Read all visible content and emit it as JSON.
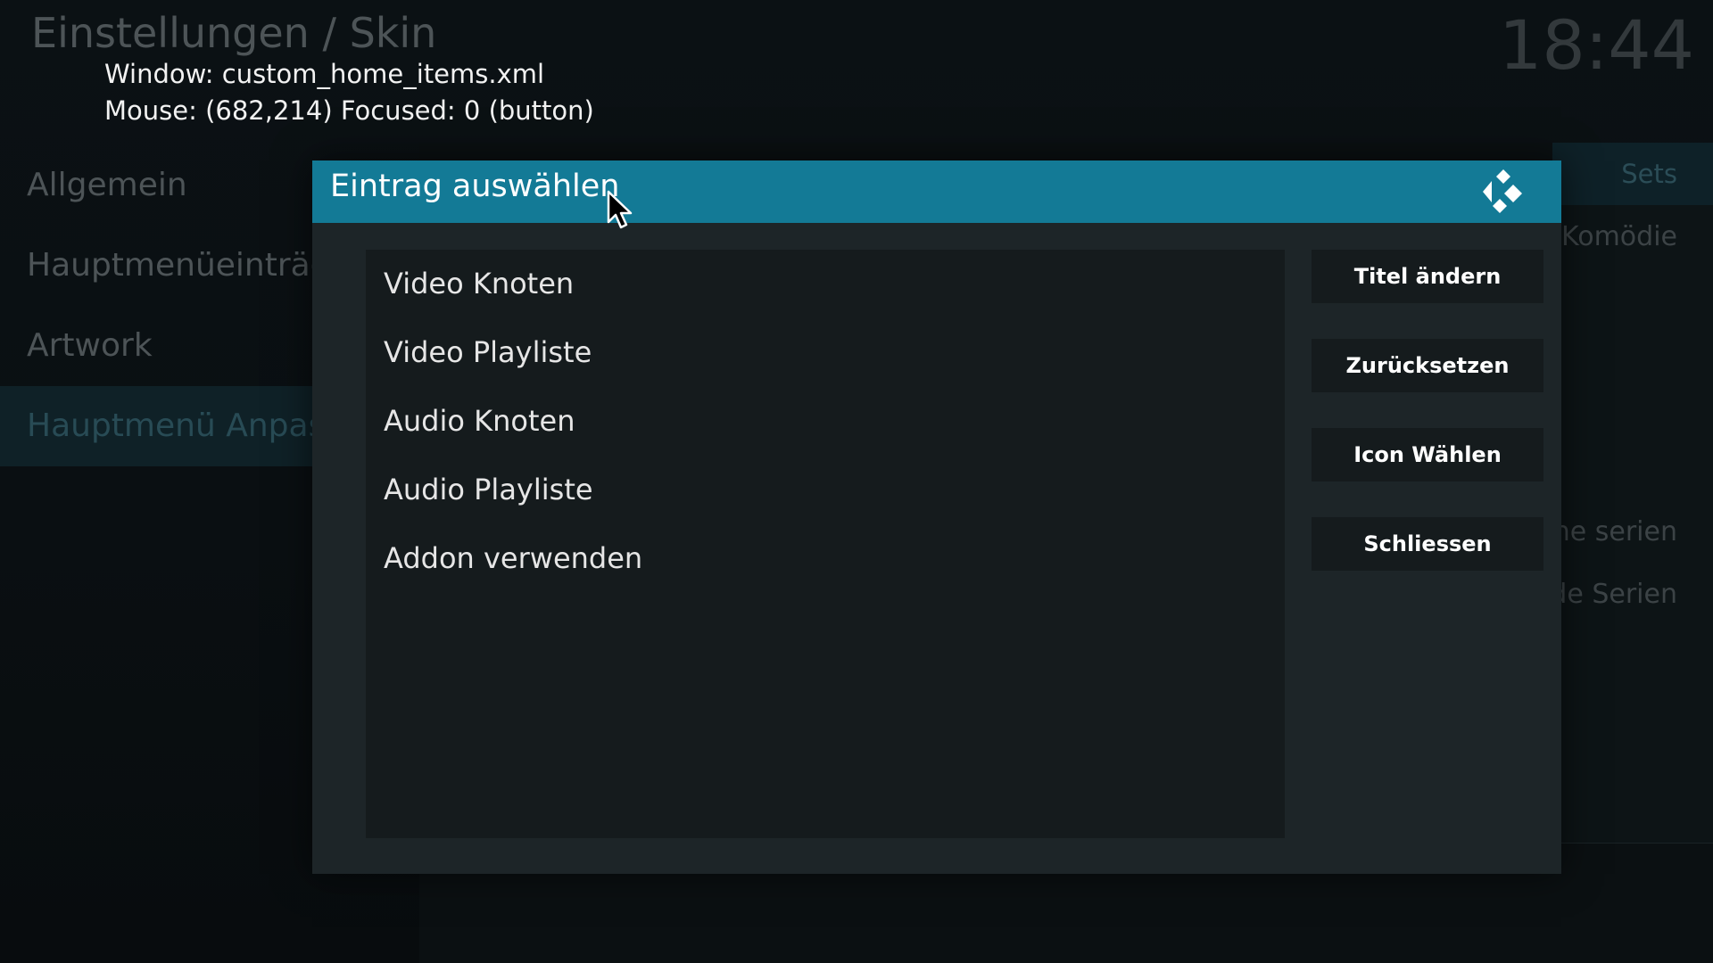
{
  "header": {
    "title": "Einstellungen / Skin",
    "clock": "18:44"
  },
  "debug": {
    "window": "Window: custom_home_items.xml",
    "mouse": "Mouse: (682,214)  Focused: 0 (button)"
  },
  "categories": [
    {
      "label": "Allgemein"
    },
    {
      "label": "Hauptmenüeinträge"
    },
    {
      "label": "Artwork"
    },
    {
      "label": "Hauptmenü Anpassen",
      "selected": true
    }
  ],
  "background": {
    "tab_label": "Sets",
    "items": [
      "- Komödie",
      "ene serien",
      "nde Serien"
    ]
  },
  "dialog": {
    "title": "Eintrag auswählen",
    "logo_icon": "kodi-logo-icon",
    "list_items": [
      "Video Knoten",
      "Video Playliste",
      "Audio Knoten",
      "Audio Playliste",
      "Addon verwenden"
    ],
    "buttons": [
      "Titel ändern",
      "Zurücksetzen",
      "Icon Wählen",
      "Schliessen"
    ]
  },
  "colors": {
    "accent": "#137a96",
    "dialog_bg": "#1d2528",
    "list_bg": "#151b1d",
    "selected_category_bg": "#0f2127"
  }
}
